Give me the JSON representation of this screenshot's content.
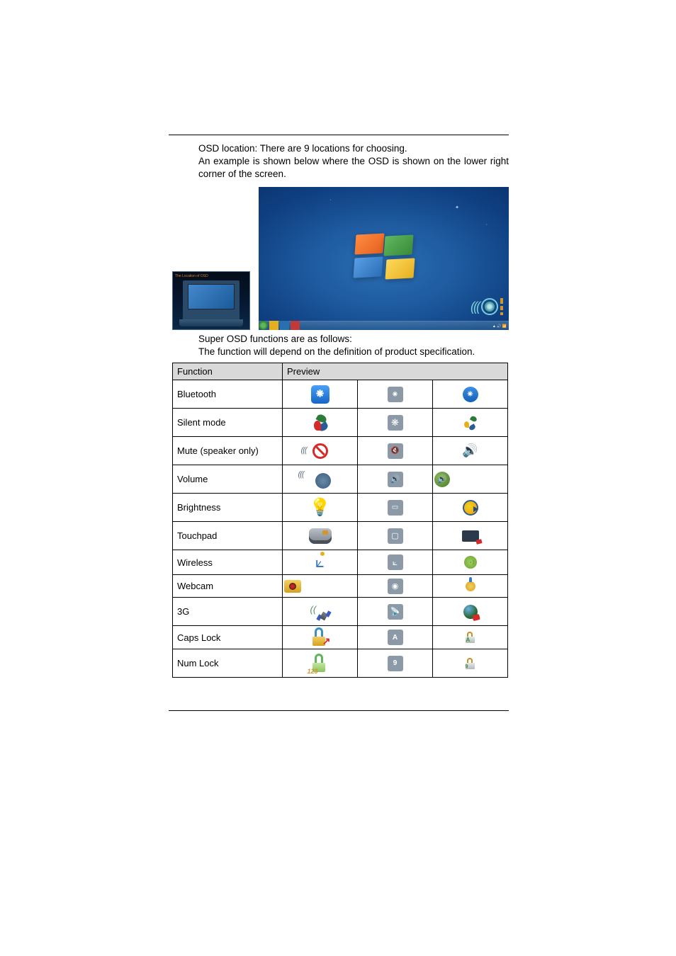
{
  "intro": {
    "line1": "OSD location: There are 9 locations for choosing.",
    "line2": "An example is shown below where the OSD is shown on the lower right corner of the screen."
  },
  "laptop_label": "The Location of OSD",
  "after_images": {
    "line1": "Super OSD functions are as follows:",
    "line2": "The function will depend on the definition of product specification."
  },
  "table": {
    "headers": {
      "function": "Function",
      "preview": "Preview"
    },
    "rows": [
      {
        "name": "Bluetooth"
      },
      {
        "name": "Silent mode"
      },
      {
        "name": "Mute (speaker only)"
      },
      {
        "name": "Volume"
      },
      {
        "name": "Brightness"
      },
      {
        "name": "Touchpad"
      },
      {
        "name": "Wireless"
      },
      {
        "name": "Webcam"
      },
      {
        "name": "3G"
      },
      {
        "name": "Caps Lock"
      },
      {
        "name": "Num Lock"
      }
    ]
  }
}
